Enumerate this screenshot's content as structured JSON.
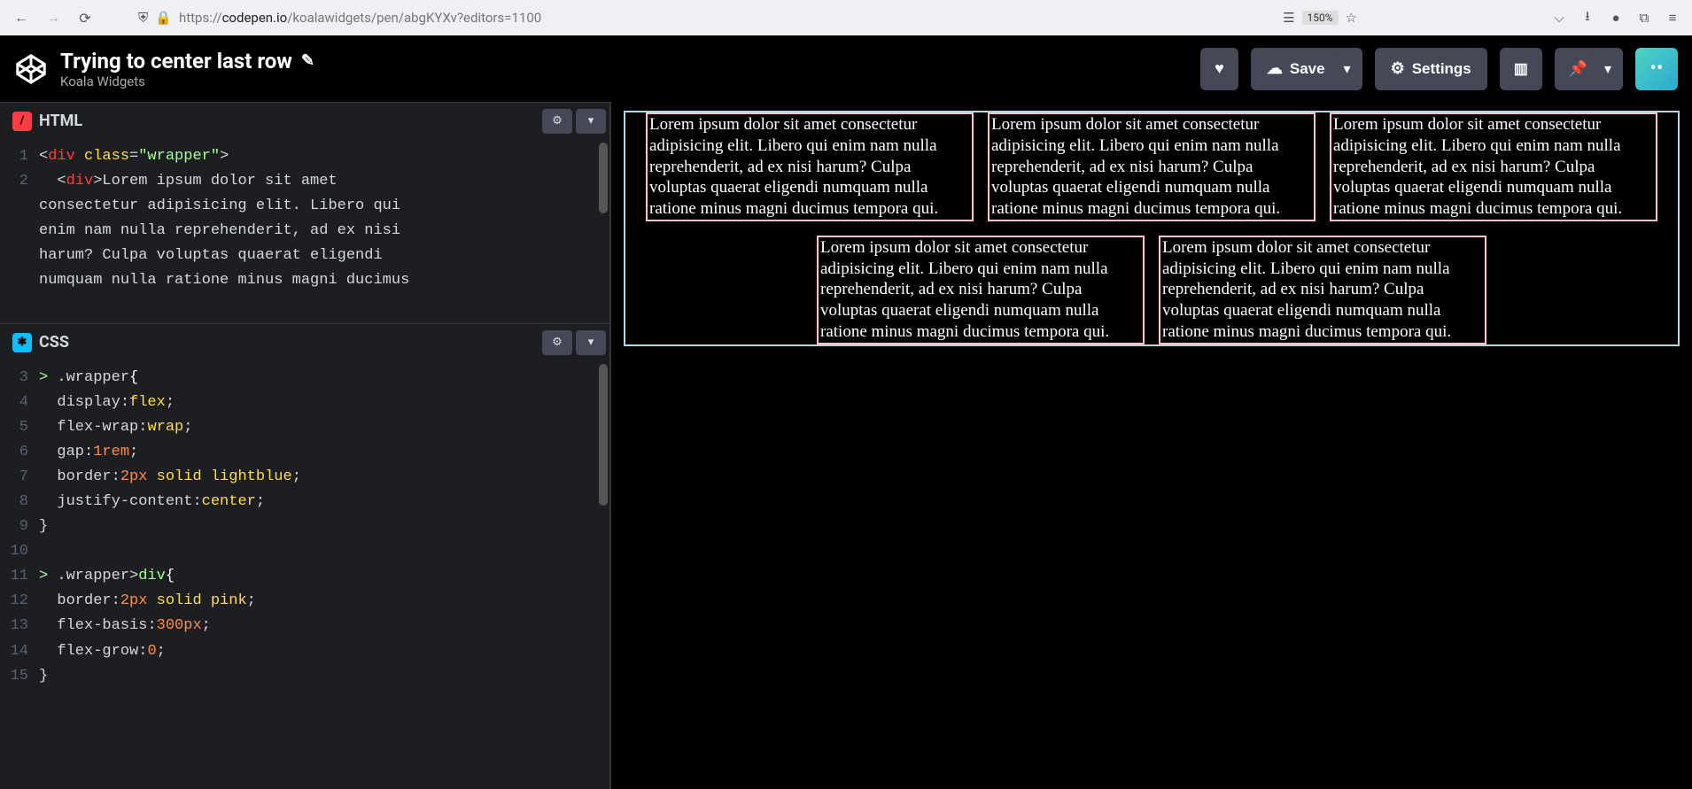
{
  "browser": {
    "url_prefix": "https://",
    "url_domain": "codepen.io",
    "url_path": "/koalawidgets/pen/abgKYXv?editors=1100",
    "zoom": "150%"
  },
  "header": {
    "title": "Trying to center last row",
    "author": "Koala Widgets",
    "save": "Save",
    "settings": "Settings"
  },
  "panes": {
    "html_label": "HTML",
    "css_label": "CSS"
  },
  "html_code": [
    {
      "n": "1",
      "indent": "",
      "raw": "<div class=\"wrapper\">"
    },
    {
      "n": "2",
      "indent": "  ",
      "raw": "<div>Lorem ipsum dolor sit amet consectetur adipisicing elit. Libero qui enim nam nulla reprehenderit, ad ex nisi harum? Culpa voluptas quaerat eligendi numquam nulla ratione minus magni ducimus"
    }
  ],
  "css_code": [
    {
      "n": "3",
      "txt": ".wrapper{"
    },
    {
      "n": "4",
      "txt": "  display:flex;"
    },
    {
      "n": "5",
      "txt": "  flex-wrap:wrap;"
    },
    {
      "n": "6",
      "txt": "  gap:1rem;"
    },
    {
      "n": "7",
      "txt": "  border:2px solid lightblue;"
    },
    {
      "n": "8",
      "txt": "  justify-content:center;"
    },
    {
      "n": "9",
      "txt": "}"
    },
    {
      "n": "10",
      "txt": ""
    },
    {
      "n": "11",
      "txt": ".wrapper>div{"
    },
    {
      "n": "12",
      "txt": "  border:2px solid pink;"
    },
    {
      "n": "13",
      "txt": "  flex-basis:300px;"
    },
    {
      "n": "14",
      "txt": "  flex-grow:0;"
    },
    {
      "n": "15",
      "txt": "}"
    }
  ],
  "preview_text": "Lorem ipsum dolor sit amet consectetur adipisicing elit. Libero qui enim nam nulla reprehenderit, ad ex nisi harum? Culpa voluptas quaerat eligendi numquam nulla ratione minus magni ducimus tempora qui.",
  "preview_count": 5
}
